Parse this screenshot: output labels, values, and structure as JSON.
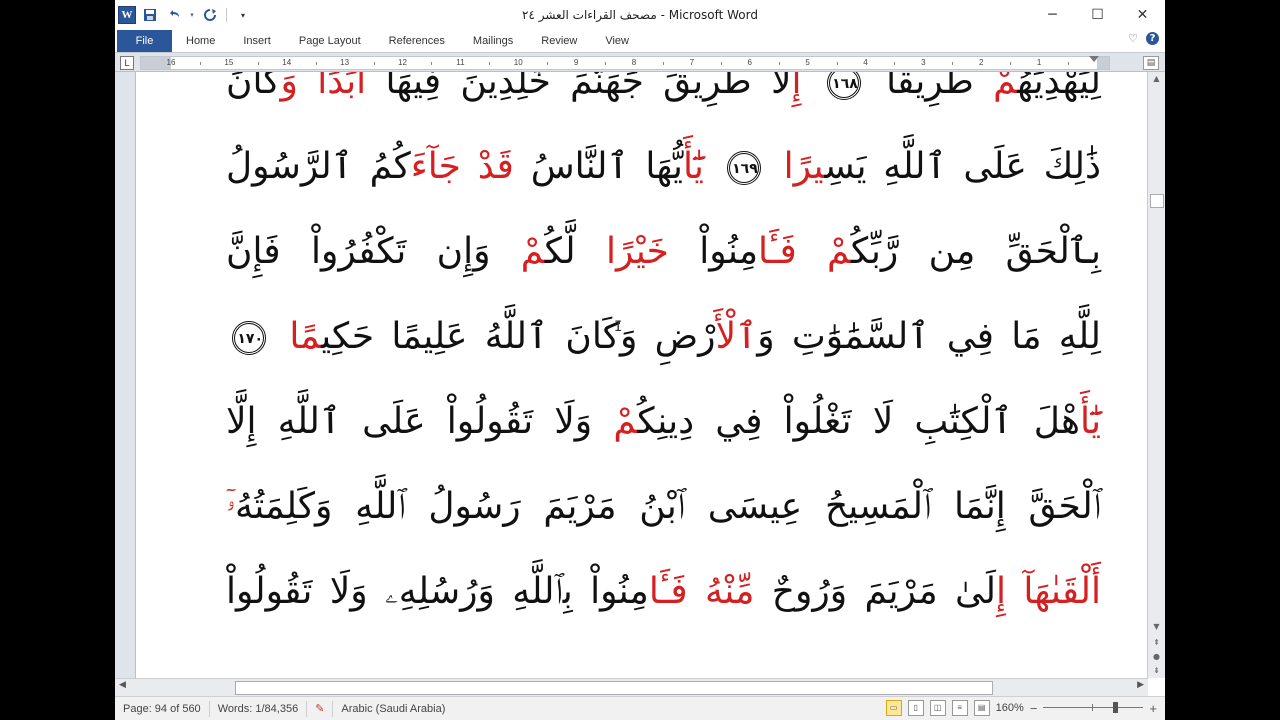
{
  "window": {
    "title": "مصحف القراءات العشر ٢٤ - Microsoft Word",
    "controls": {
      "minimize": "─",
      "maximize": "☐",
      "close": "✕"
    }
  },
  "qat": {
    "logo": "W",
    "save_icon": "save-icon",
    "undo_icon": "undo-icon",
    "redo_icon": "redo-icon",
    "customize_icon": "customize-icon"
  },
  "ribbon": {
    "tabs": [
      "File",
      "Home",
      "Insert",
      "Page Layout",
      "References",
      "Mailings",
      "Review",
      "View"
    ],
    "help": "?"
  },
  "ruler": {
    "corner": "L",
    "numbers": [
      "16",
      "15",
      "14",
      "13",
      "12",
      "11",
      "10",
      "9",
      "8",
      "7",
      "6",
      "5",
      "4",
      "3",
      "2",
      "1"
    ]
  },
  "document": {
    "lines": [
      [
        {
          "t": "لِيَهْدِيَهُ"
        },
        {
          "t": "مْ",
          "red": true
        },
        {
          "t": " طَرِيقًا "
        },
        {
          "mark": "١٦٨"
        },
        {
          "t": " إِ",
          "red": true
        },
        {
          "t": "لا طَرِيقَ جَهَنَّمَ خَٰلِدِينَ فِيهَا "
        },
        {
          "t": "أَبَدًا وَ",
          "red": true
        },
        {
          "t": "كَانَ"
        }
      ],
      [
        {
          "t": "ذَٰلِكَ عَلَى ٱللَّهِ يَسِ"
        },
        {
          "t": "يرًا",
          "red": true
        },
        {
          "t": " "
        },
        {
          "mark": "١٦٩"
        },
        {
          "t": " "
        },
        {
          "t": "يَٰٓأَ",
          "red": true
        },
        {
          "t": "يُّهَا ٱلنَّاسُ "
        },
        {
          "t": "قَدْ جَآءَ",
          "red": true
        },
        {
          "t": "كُمُ ٱلرَّسُولُ"
        }
      ],
      [
        {
          "t": "بِٱلْحَقِّ مِن رَّبِّكُ"
        },
        {
          "t": "مْ فَـَٔا",
          "red": true
        },
        {
          "t": "مِنُواْ "
        },
        {
          "t": "خَيْرًا",
          "red": true
        },
        {
          "t": " لَّكُ"
        },
        {
          "t": "مْ",
          "red": true
        },
        {
          "t": " وَإِن تَكْفُرُواْ فَإِنَّ"
        }
      ],
      [
        {
          "t": "لِلَّهِ مَا فِي ٱلسَّمَٰوَٰتِ وَ"
        },
        {
          "t": "ٱلْأَ",
          "red": true
        },
        {
          "t": "رْضِ وَكَانَ ٱللَّهُ عَلِيمًا حَكِي"
        },
        {
          "t": "مًا",
          "red": true
        },
        {
          "t": " "
        },
        {
          "mark": "١٧٠"
        }
      ],
      [
        {
          "t": "يَٰٓأَ",
          "red": true
        },
        {
          "t": "هْلَ ٱلْكِتَٰبِ لَا تَغْلُواْ فِي دِينِكُ"
        },
        {
          "t": "مْ",
          "red": true
        },
        {
          "t": " وَلَا تَقُولُواْ عَلَى ٱللَّهِ إِلَّا"
        }
      ],
      [
        {
          "t": "ٱلْحَقَّ إِنَّمَا ٱلْمَسِيحُ عِيسَى ٱبْنُ مَرْيَمَ رَسُولُ ٱللَّهِ وَكَلِمَتُهُ"
        },
        {
          "t": "ۥٓ",
          "red": true
        }
      ],
      [
        {
          "t": "أَلْقَىٰهَآ إِ",
          "red": true
        },
        {
          "t": "لَىٰ مَرْيَمَ وَرُوحٌ "
        },
        {
          "t": "مِّنْهُ فَـَٔا",
          "red": true
        },
        {
          "t": "مِنُواْ بِٱللَّهِ وَرُسُلِهِۦ وَلَا تَقُولُواْ"
        }
      ]
    ]
  },
  "statusbar": {
    "page": "Page: 94 of 560",
    "words": "Words: 1/84,356",
    "language": "Arabic (Saudi Arabia)",
    "zoom": "160%",
    "zoom_minus": "−",
    "zoom_plus": "+",
    "zoom_level": 0.72
  },
  "colors": {
    "accent": "#2b579a",
    "quran_red": "#d42020"
  }
}
